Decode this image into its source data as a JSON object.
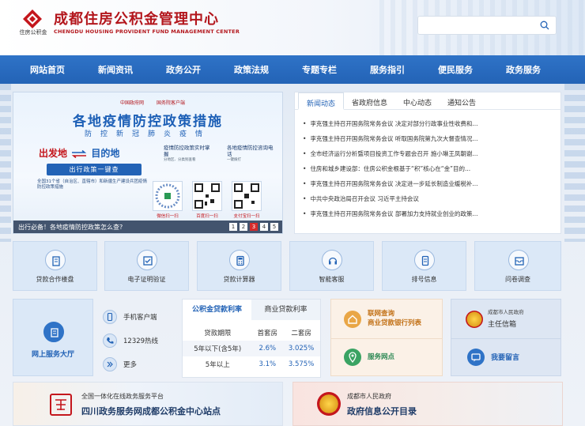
{
  "header": {
    "logo_caption": "住房公积金",
    "title": "成都住房公积金管理中心",
    "subtitle": "CHENGDU HOUSING PROVIDENT FUND MANAGEMENT CENTER",
    "search_placeholder": ""
  },
  "nav": {
    "items": [
      {
        "label": "网站首页"
      },
      {
        "label": "新闻资讯"
      },
      {
        "label": "政务公开"
      },
      {
        "label": "政策法规"
      },
      {
        "label": "专题专栏"
      },
      {
        "label": "服务指引"
      },
      {
        "label": "便民服务"
      },
      {
        "label": "政务服务"
      }
    ]
  },
  "banner": {
    "logo_left": "中国政府网",
    "logo_right": "国务院客户端",
    "headline": "各地疫情防控政策措施",
    "sub": "防控新冠肺炎疫情",
    "from": "出发地",
    "to": "目的地",
    "button": "出行政策一键查",
    "fine_print": "全国31个省（自治区、直辖市）和新疆生产建设兵团疫情防控政策措施",
    "info1_title": "疫情防控政策实时掌握",
    "info1_small": "分地区、分类别查看",
    "info2_title": "各地疫情防控咨询电话",
    "info2_small": "一键拨打",
    "qr_labels": [
      "微信扫一扫",
      "百度扫一扫",
      "支付宝扫一扫"
    ],
    "caption": "出行必备！各地疫情防控政策怎么查?",
    "pages": [
      "1",
      "2",
      "3",
      "4",
      "5"
    ],
    "active_page": "3"
  },
  "news": {
    "tabs": [
      {
        "label": "新闻动态"
      },
      {
        "label": "省政府信息"
      },
      {
        "label": "中心动态"
      },
      {
        "label": "通知公告"
      }
    ],
    "items": [
      "李克强主持召开国务院常务会议 决定对部分行政事业性收费和...",
      "李克强主持召开国务院常务会议 听取国务院第九次大督查情况...",
      "全市经济运行分析暨项目投资工作专题会召开 施小琳王凤朝谢...",
      "住房和城乡建设部：住房公积金根基于“积”核心在“金”目的...",
      "李克强主持召开国务院常务会议 决定进一步延长制造业缓税补...",
      "中共中央政治局召开会议 习近平主持会议",
      "李克强主持召开国务院常务会议 部署加力支持就业创业的政策..."
    ]
  },
  "services": [
    {
      "label": "贷款合作楼盘"
    },
    {
      "label": "电子证明验证"
    },
    {
      "label": "贷款计算器"
    },
    {
      "label": "智能客服"
    },
    {
      "label": "排号信息"
    },
    {
      "label": "问卷调查"
    }
  ],
  "online_hall": {
    "label": "网上服务大厅"
  },
  "quick_links": [
    {
      "label": "手机客户端"
    },
    {
      "label": "12329热线"
    },
    {
      "label": "更多"
    }
  ],
  "rates": {
    "tabs": [
      {
        "label": "公积金贷款利率"
      },
      {
        "label": "商业贷款利率"
      }
    ],
    "headers": [
      "贷款期限",
      "首套房",
      "二套房"
    ],
    "rows": [
      {
        "term": "5年以下(含5年)",
        "first": "2.6%",
        "second": "3.025%"
      },
      {
        "term": "5年以上",
        "first": "3.1%",
        "second": "3.575%"
      }
    ]
  },
  "pink_block": {
    "query_line1": "联网查询",
    "query_line2": "商业贷款银行列表",
    "outlets": "服务网点"
  },
  "right_block": {
    "small": "成都市人民政府",
    "mayor_mailbox": "主任信箱",
    "message": "我要留言"
  },
  "bottom_left": {
    "small": "全国一体化在线政务服务平台",
    "main": "四川政务服务网成都公积金中心站点"
  },
  "bottom_right": {
    "small": "成都市人民政府",
    "main": "政府信息公开目录"
  },
  "colors": {
    "brand_red": "#b3161c",
    "nav_blue": "#2363b6",
    "active_dot": "#d62a2a"
  }
}
